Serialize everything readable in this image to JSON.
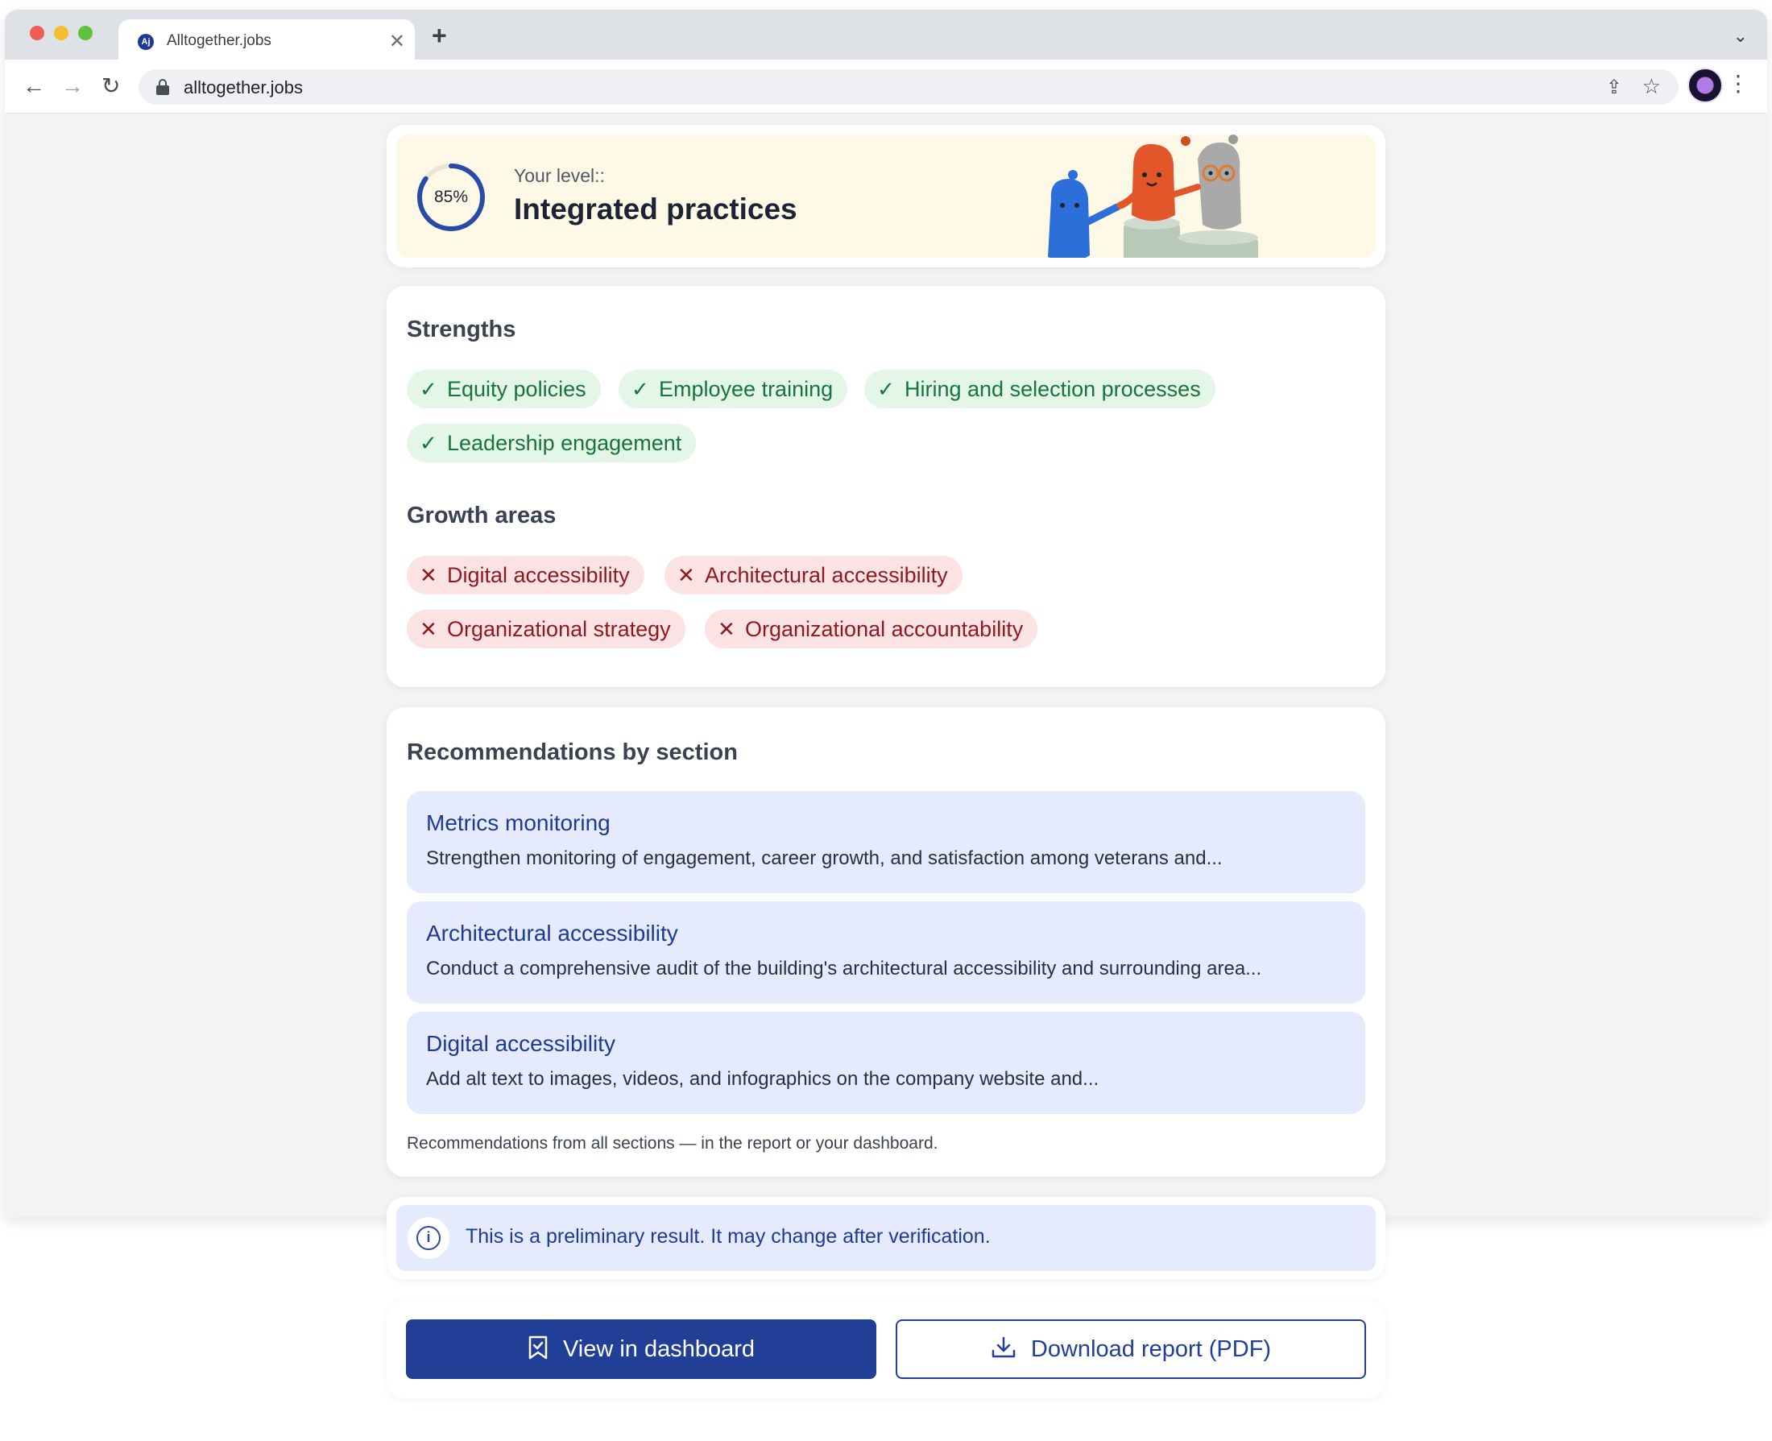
{
  "browser": {
    "tab_title": "Alltogether.jobs",
    "favicon_label": "Aj",
    "url": "alltogether.jobs"
  },
  "level": {
    "percent": 85,
    "percent_label": "85%",
    "caption": "Your level::",
    "title": "Integrated practices"
  },
  "strengths": {
    "heading": "Strengths",
    "items": [
      "Equity policies",
      "Employee training",
      "Hiring and selection processes",
      "Leadership engagement"
    ]
  },
  "growth": {
    "heading": "Growth areas",
    "items": [
      "Digital accessibility",
      "Architectural accessibility",
      "Organizational strategy",
      "Organizational accountability"
    ]
  },
  "recommendations": {
    "heading": "Recommendations by section",
    "items": [
      {
        "title": "Metrics monitoring",
        "description": "Strengthen monitoring of engagement, career growth, and satisfaction among veterans and..."
      },
      {
        "title": "Architectural accessibility",
        "description": "Conduct a comprehensive audit of the building's architectural accessibility and surrounding area..."
      },
      {
        "title": "Digital accessibility",
        "description": "Add alt text to images, videos, and infographics on the company website and..."
      }
    ],
    "footnote": "Recommendations from all sections — in the report or your dashboard."
  },
  "notice": {
    "text": "This is a preliminary result. It may change after verification."
  },
  "actions": {
    "dashboard_label": "View in dashboard",
    "download_label": "Download report (PDF)"
  },
  "colors": {
    "primary": "#223f98",
    "ring": "#2a4aa8",
    "strength_bg": "#e3f6e8",
    "strength_fg": "#18743a",
    "growth_bg": "#fbe3e4",
    "growth_fg": "#8e1a1f",
    "reco_bg": "#e5ebfd",
    "level_bg": "#fdf9e6"
  },
  "icons": {
    "check": "check-icon",
    "cross": "cross-icon",
    "info": "info-icon",
    "bookmark": "bookmark-icon",
    "download": "download-icon"
  }
}
